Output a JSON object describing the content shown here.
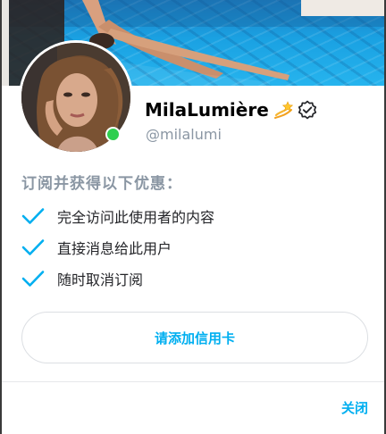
{
  "profile": {
    "name": "MilaLumière",
    "handle": "@milalumi",
    "online": true
  },
  "icons": {
    "name_emoji": "dizzy-star-icon",
    "verified": "verified-badge-icon",
    "benefit_check": "checkmark-icon"
  },
  "benefits": {
    "title": "订阅并获得以下优惠：",
    "items": [
      "完全访问此使用者的内容",
      "直接消息给此用户",
      "随时取消订阅"
    ]
  },
  "actions": {
    "add_card_label": "请添加信用卡",
    "close_label": "关闭"
  },
  "colors": {
    "accent": "#00aff0",
    "muted": "#8a96a3",
    "online": "#2fcf4f",
    "text": "#242529"
  }
}
